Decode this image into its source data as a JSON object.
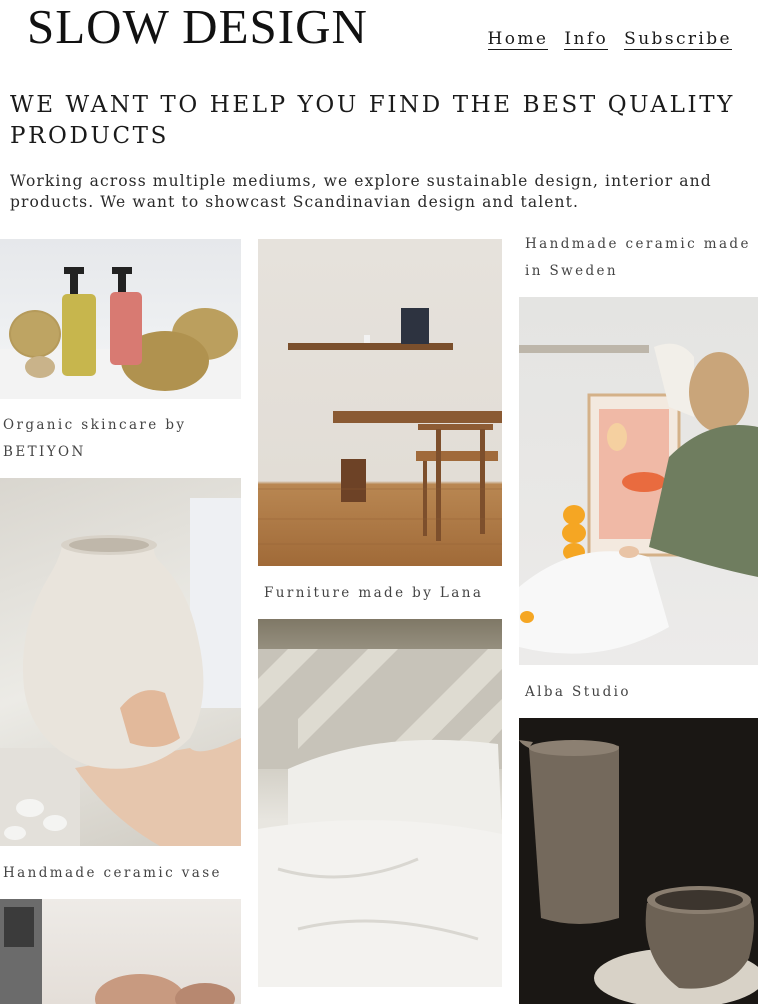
{
  "header": {
    "logo": "SLOW DESIGN",
    "nav": [
      {
        "label": "Home"
      },
      {
        "label": "Info"
      },
      {
        "label": "Subscribe"
      }
    ]
  },
  "hero": {
    "headline": "WE WANT TO HELP YOU FIND THE BEST QUALITY PRODUCTS",
    "intro": "Working across multiple mediums, we explore sustainable design, interior and products. We want to showcast Scandinavian design and talent."
  },
  "gallery": {
    "col1": [
      {
        "caption": "Organic skincare by BETIYON",
        "brand": "BETIYON"
      },
      {
        "caption": "Handmade ceramic vase"
      }
    ],
    "col2": [
      {
        "caption": "Furniture made by Lana"
      }
    ],
    "col3": [
      {
        "caption": "Handmade ceramic made in Sweden"
      },
      {
        "caption": "Alba Studio"
      }
    ]
  },
  "colors": {
    "text": "#1a1a1a",
    "caption": "#444444",
    "background": "#ffffff"
  }
}
